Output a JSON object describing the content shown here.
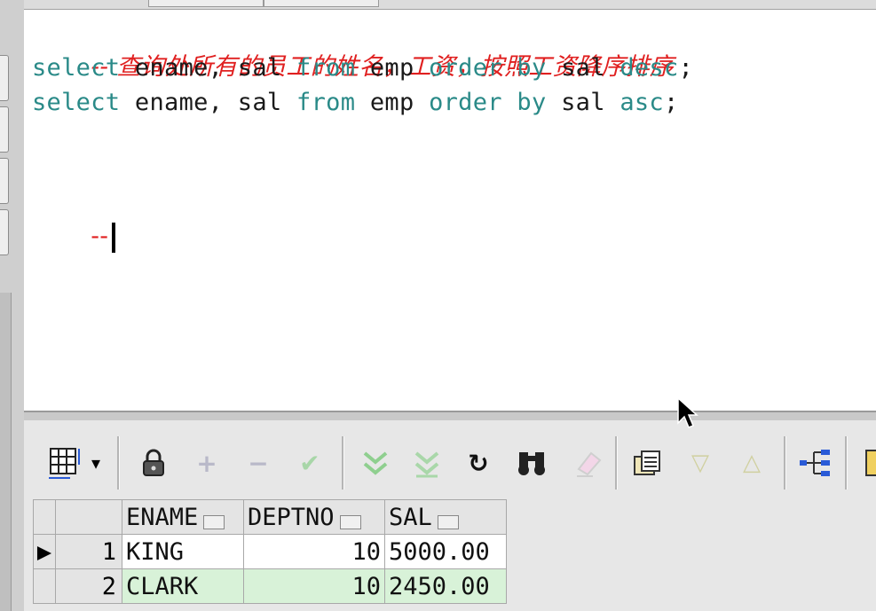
{
  "editor": {
    "lines": [
      {
        "type": "comment",
        "text": "-- 查询处所有的员工的姓名，工资，按照工资降序排序"
      },
      {
        "type": "sql",
        "kw1": "select",
        "cols": "ename, sal",
        "kw2": "from",
        "table": "emp",
        "kw3": "order by",
        "col": "sal",
        "kw4": "desc",
        "end": ";"
      },
      {
        "type": "sql",
        "kw1": "select",
        "cols": "ename, sal",
        "kw2": "from",
        "table": "emp",
        "kw3": "order by",
        "col": "sal",
        "kw4": "asc",
        "end": ";"
      },
      {
        "type": "comment",
        "text": "--"
      }
    ]
  },
  "toolbar": {
    "icons": [
      "grid-layout-icon",
      "lock-icon",
      "plus-icon",
      "minus-icon",
      "check-icon",
      "fetch-next-icon",
      "fetch-last-icon",
      "refresh-icon",
      "find-icon",
      "clear-icon",
      "export-icon",
      "triangle-down-icon",
      "triangle-up-icon",
      "tree-icon"
    ],
    "glyphs": {
      "plus": "+",
      "minus": "−",
      "check": "✔",
      "refresh": "↻",
      "find": "👓",
      "down": "▽",
      "up": "△",
      "dropdown": "▾"
    }
  },
  "grid": {
    "columns": [
      "ENAME",
      "DEPTNO",
      "SAL"
    ],
    "rows": [
      {
        "num": "1",
        "ename": "KING",
        "deptno": "10",
        "sal": "5000.00"
      },
      {
        "num": "2",
        "ename": "CLARK",
        "deptno": "10",
        "sal": "2450.00"
      }
    ],
    "current_row_marker": "▶"
  },
  "colors": {
    "keyword": "#2a8a88",
    "comment": "#e02020",
    "selected_row": "#d8f2d8"
  }
}
